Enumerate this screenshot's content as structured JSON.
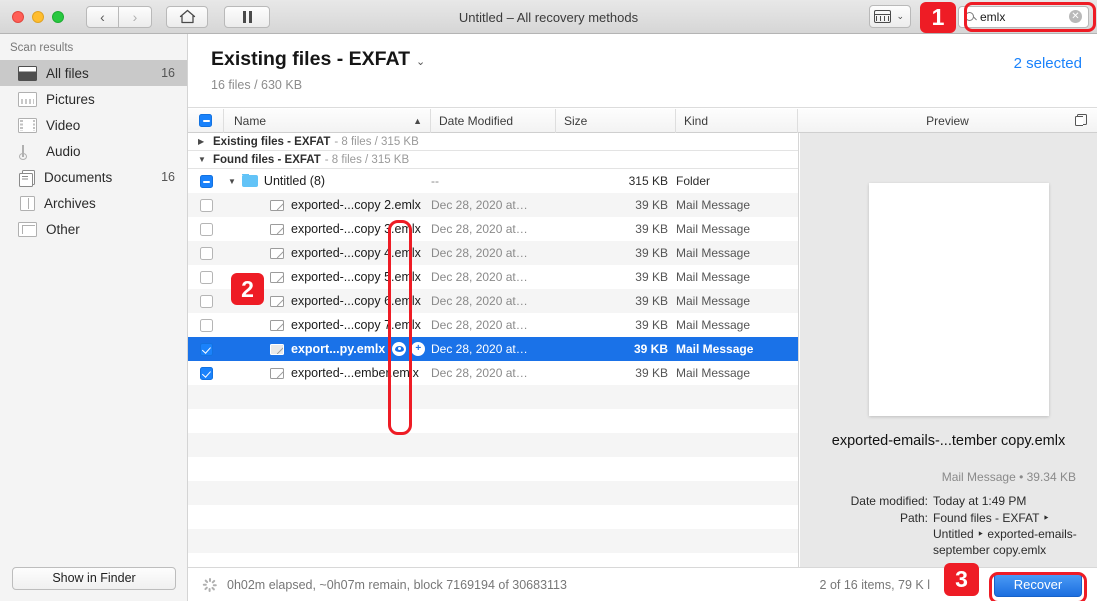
{
  "window": {
    "title": "Untitled – All recovery methods",
    "traffic_lights": [
      "close",
      "minimize",
      "zoom"
    ],
    "nav": {
      "back": "‹",
      "forward": "›"
    },
    "home_icon": "home-icon",
    "pause_icon": "pause-icon",
    "view_switcher_icon": "grid-view-icon",
    "view_switcher_chevron": "⌄"
  },
  "search": {
    "value": "emlx",
    "icon": "search-icon",
    "clear": "✕"
  },
  "badges": {
    "one": "1",
    "two": "2",
    "three": "3"
  },
  "accent": {
    "blue": "#1a82fb",
    "selection": "#1a72e8",
    "red": "#ee1c25",
    "folder": "#62c3f7"
  },
  "sidebar": {
    "header": "Scan results",
    "items": [
      {
        "label": "All files",
        "count": "16",
        "icon": "all-files-icon",
        "active": true
      },
      {
        "label": "Pictures",
        "count": "",
        "icon": "pictures-icon",
        "active": false
      },
      {
        "label": "Video",
        "count": "",
        "icon": "video-icon",
        "active": false
      },
      {
        "label": "Audio",
        "count": "",
        "icon": "audio-icon",
        "active": false
      },
      {
        "label": "Documents",
        "count": "16",
        "icon": "documents-icon",
        "active": false
      },
      {
        "label": "Archives",
        "count": "",
        "icon": "archives-icon",
        "active": false
      },
      {
        "label": "Other",
        "count": "",
        "icon": "other-icon",
        "active": false
      }
    ],
    "show_in_finder": "Show in Finder"
  },
  "content": {
    "title": "Existing files - EXFAT",
    "title_chevron": "⌄",
    "subtitle": "16 files / 630 KB",
    "selected_label": "2 selected"
  },
  "table": {
    "columns": {
      "name": "Name",
      "sort_arrow": "▲",
      "date_modified": "Date Modified",
      "size": "Size",
      "kind": "Kind",
      "preview": "Preview"
    },
    "master_checkbox_state": "mixed",
    "groups": [
      {
        "name": "Existing files - EXFAT",
        "meta": "- 8 files / 315 KB",
        "expanded": false,
        "triangle": "▶"
      },
      {
        "name": "Found files - EXFAT",
        "meta": "- 8 files / 315 KB",
        "expanded": true,
        "triangle": "▼"
      }
    ],
    "folder_row": {
      "triangle": "▼",
      "name": "Untitled (8)",
      "date": "--",
      "size": "315 KB",
      "kind": "Folder",
      "checkbox": "mixed"
    },
    "rows": [
      {
        "name": "exported-...copy 2.emlx",
        "date": "Dec 28, 2020 at…",
        "size": "39 KB",
        "kind": "Mail Message",
        "checked": false,
        "selected": false
      },
      {
        "name": "exported-...copy 3.emlx",
        "date": "Dec 28, 2020 at…",
        "size": "39 KB",
        "kind": "Mail Message",
        "checked": false,
        "selected": false
      },
      {
        "name": "exported-...copy 4.emlx",
        "date": "Dec 28, 2020 at…",
        "size": "39 KB",
        "kind": "Mail Message",
        "checked": false,
        "selected": false
      },
      {
        "name": "exported-...copy 5.emlx",
        "date": "Dec 28, 2020 at…",
        "size": "39 KB",
        "kind": "Mail Message",
        "checked": false,
        "selected": false
      },
      {
        "name": "exported-...copy 6.emlx",
        "date": "Dec 28, 2020 at…",
        "size": "39 KB",
        "kind": "Mail Message",
        "checked": false,
        "selected": false
      },
      {
        "name": "exported-...copy 7.emlx",
        "date": "Dec 28, 2020 at…",
        "size": "39 KB",
        "kind": "Mail Message",
        "checked": false,
        "selected": false
      },
      {
        "name": "export...py.emlx",
        "date": "Dec 28, 2020 at…",
        "size": "39 KB",
        "kind": "Mail Message",
        "checked": true,
        "selected": true,
        "actions": [
          "preview-eye-icon",
          "add-icon"
        ]
      },
      {
        "name": "exported-...ember.emlx",
        "date": "Dec 28, 2020 at…",
        "size": "39 KB",
        "kind": "Mail Message",
        "checked": true,
        "selected": false
      }
    ]
  },
  "preview": {
    "header": "Preview",
    "copy_icon": "copy-icon",
    "filename": "exported-emails-...tember copy.emlx",
    "kind_and_size": "Mail Message • 39.34 KB",
    "details": [
      {
        "key": "Date modified:",
        "value": "Today at 1:49 PM"
      },
      {
        "key": "Path:",
        "value": "Found files - EXFAT ‣ Untitled ‣ exported-emails-september copy.emlx"
      }
    ]
  },
  "status": {
    "spinner_icon": "progress-spinner-icon",
    "progress_text": "0h02m elapsed, ~0h07m remain, block 7169194 of 30683113",
    "items_text": "2 of 16 items, 79 K            l",
    "recover_label": "Recover"
  }
}
